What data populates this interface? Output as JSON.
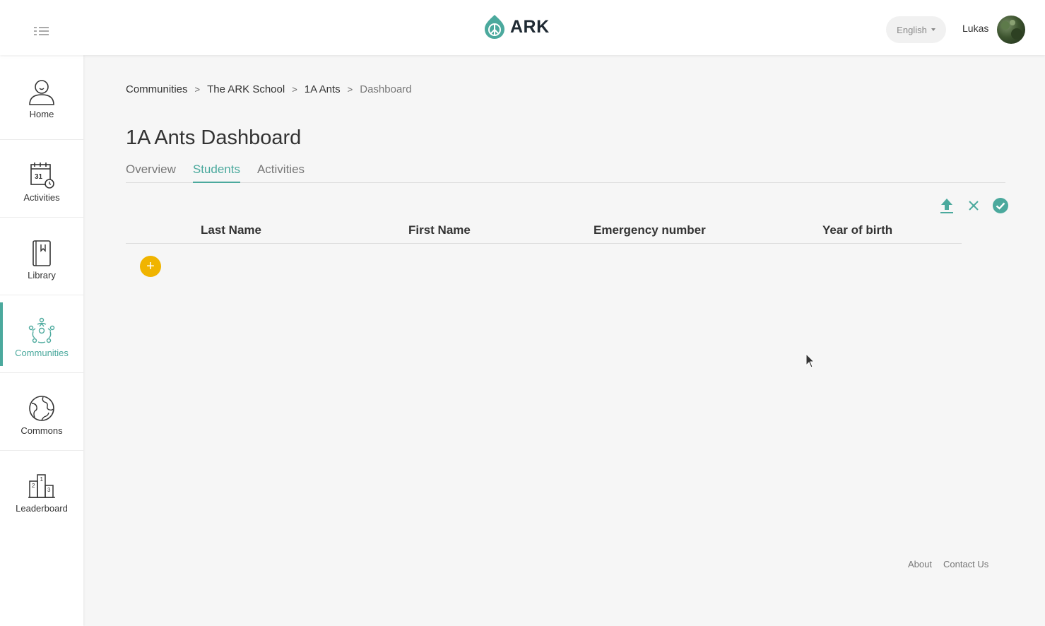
{
  "header": {
    "menu_icon": "menu-list-icon",
    "logo_text": "ARK",
    "language": "English",
    "username": "Lukas"
  },
  "sidebar": {
    "items": [
      {
        "label": "Home",
        "icon": "user-icon"
      },
      {
        "label": "Activities",
        "icon": "calendar-icon"
      },
      {
        "label": "Library",
        "icon": "book-icon"
      },
      {
        "label": "Communities",
        "icon": "community-icon",
        "active": true
      },
      {
        "label": "Commons",
        "icon": "globe-icon"
      },
      {
        "label": "Leaderboard",
        "icon": "podium-icon"
      }
    ]
  },
  "breadcrumb": [
    "Communities",
    "The ARK School",
    "1A Ants",
    "Dashboard"
  ],
  "page": {
    "title": "1A Ants Dashboard",
    "tabs": [
      "Overview",
      "Students",
      "Activities"
    ],
    "active_tab": "Students"
  },
  "table": {
    "columns": [
      "Last Name",
      "First Name",
      "Emergency number",
      "Year of birth"
    ],
    "rows": []
  },
  "actions": [
    "upload-icon",
    "close-icon",
    "check-circle-icon"
  ],
  "add_button_glyph": "+",
  "footer": {
    "about": "About",
    "contact": "Contact Us"
  },
  "colors": {
    "accent": "#4ba99d",
    "add_button": "#f0b400",
    "background": "#f6f6f6"
  }
}
